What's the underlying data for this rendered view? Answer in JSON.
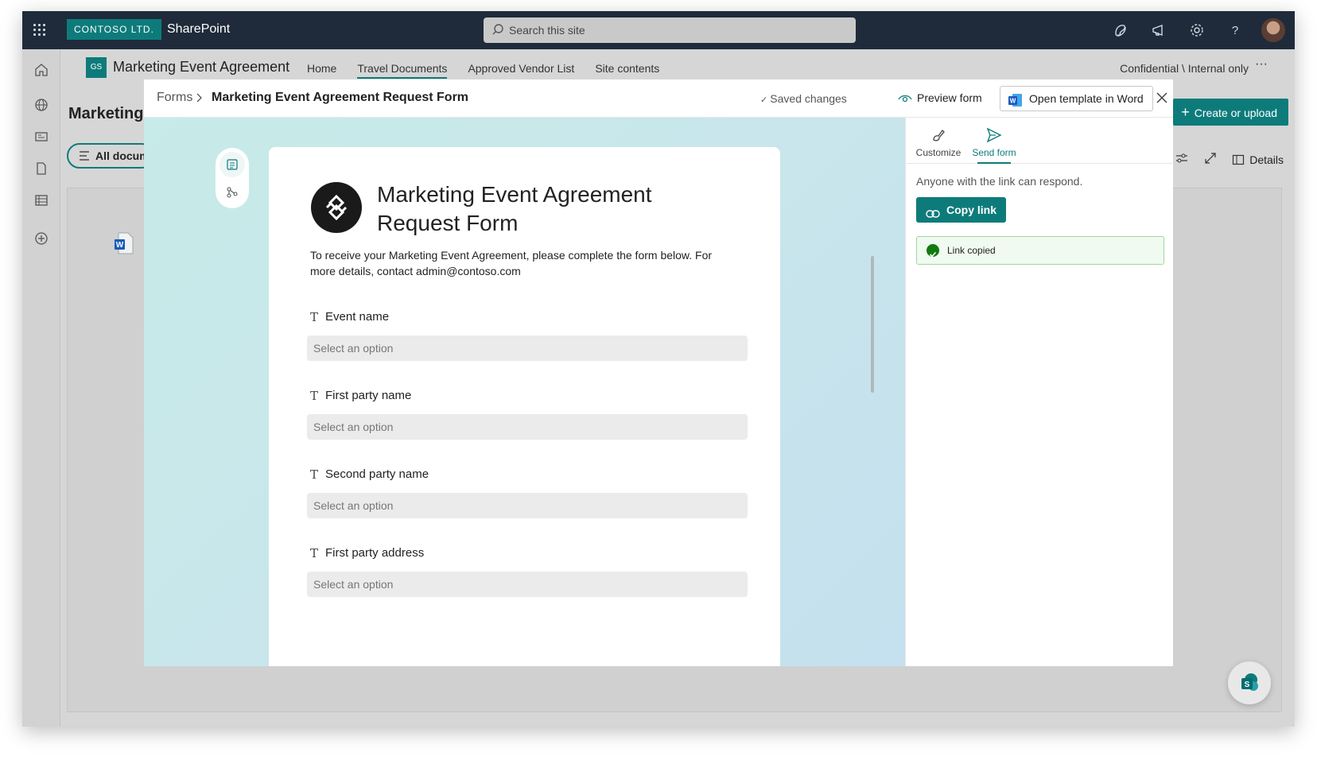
{
  "suite_bar": {
    "org_badge": "CONTOSO LTD.",
    "app_name": "SharePoint",
    "search_placeholder": "Search this site",
    "icons": [
      "waffle-icon",
      "copilot-icon",
      "megaphone-icon",
      "gear-icon",
      "help-icon",
      "avatar"
    ]
  },
  "rail": {
    "icons": [
      "home-icon",
      "globe-icon",
      "news-icon",
      "document-icon",
      "list-icon",
      "add-circle-icon"
    ]
  },
  "site": {
    "logo_initials": "GS",
    "title": "Marketing Event Agreement",
    "nav": [
      "Home",
      "Travel Documents",
      "Approved Vendor List",
      "Site contents"
    ],
    "active_nav": "Travel Documents",
    "sensitivity": "Confidential \\ Internal only",
    "more": "···"
  },
  "page": {
    "heading": "Marketing",
    "view_button": "All docum",
    "create_button": "Create or upload",
    "details_label": "Details"
  },
  "modal": {
    "breadcrumb": [
      "Forms",
      "Marketing Event Agreement Request Form"
    ],
    "saved_status": "Saved changes",
    "preview_label": "Preview form",
    "open_word_label": "Open template in Word",
    "form": {
      "title": "Marketing Event Agreement Request Form",
      "description": "To receive your Marketing Event Agreement, please complete the form below. For more details, contact admin@contoso.com",
      "fields": [
        {
          "label": "Event name",
          "placeholder": "Select an option"
        },
        {
          "label": "First party name",
          "placeholder": "Select an option"
        },
        {
          "label": "Second party name",
          "placeholder": "Select an option"
        },
        {
          "label": "First party address",
          "placeholder": "Select an option"
        }
      ]
    },
    "side_panel": {
      "tabs": [
        "Customize",
        "Send form"
      ],
      "active_tab": "Send form",
      "info": "Anyone with the link can respond.",
      "copy_button": "Copy link",
      "toast": "Link copied"
    }
  },
  "colors": {
    "accent": "#0e7b7b",
    "suite_bar": "#1f2b3a",
    "success": "#107c10"
  }
}
